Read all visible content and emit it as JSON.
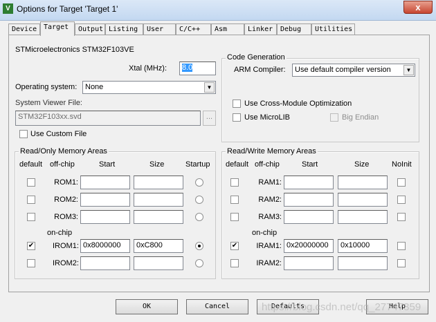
{
  "window": {
    "title": "Options for Target 'Target 1'",
    "icon": "keil-uvision-icon",
    "close": "x"
  },
  "tabs": [
    "Device",
    "Target",
    "Output",
    "Listing",
    "User",
    "C/C++",
    "Asm",
    "Linker",
    "Debug",
    "Utilities"
  ],
  "active_tab": "Target",
  "device": "STMicroelectronics STM32F103VE",
  "xtal": {
    "label": "Xtal (MHz):",
    "value": "8.0"
  },
  "os": {
    "label": "Operating system:",
    "value": "None"
  },
  "svf": {
    "label": "System Viewer File:",
    "value": "STM32F103xx.svd",
    "browse": "..."
  },
  "custom_file": {
    "label": "Use Custom File",
    "checked": false
  },
  "codegen": {
    "title": "Code Generation",
    "compiler_label": "ARM Compiler:",
    "compiler_value": "Use default compiler version",
    "cross_module": "Use Cross-Module Optimization",
    "microlib": "Use MicroLIB",
    "big_endian": "Big Endian"
  },
  "rom": {
    "title": "Read/Only Memory Areas",
    "headers": [
      "default",
      "off-chip",
      "Start",
      "Size",
      "Startup"
    ],
    "onchip": "on-chip",
    "rows": [
      {
        "name": "ROM1:",
        "start": "",
        "size": "",
        "default": false,
        "sel": false
      },
      {
        "name": "ROM2:",
        "start": "",
        "size": "",
        "default": false,
        "sel": false
      },
      {
        "name": "ROM3:",
        "start": "",
        "size": "",
        "default": false,
        "sel": false
      },
      {
        "name": "IROM1:",
        "start": "0x8000000",
        "size": "0xC800",
        "default": true,
        "sel": true
      },
      {
        "name": "IROM2:",
        "start": "",
        "size": "",
        "default": false,
        "sel": false
      }
    ]
  },
  "ram": {
    "title": "Read/Write Memory Areas",
    "headers": [
      "default",
      "off-chip",
      "Start",
      "Size",
      "NoInit"
    ],
    "onchip": "on-chip",
    "rows": [
      {
        "name": "RAM1:",
        "start": "",
        "size": "",
        "default": false,
        "sel": false
      },
      {
        "name": "RAM2:",
        "start": "",
        "size": "",
        "default": false,
        "sel": false
      },
      {
        "name": "RAM3:",
        "start": "",
        "size": "",
        "default": false,
        "sel": false
      },
      {
        "name": "IRAM1:",
        "start": "0x20000000",
        "size": "0x10000",
        "default": true,
        "sel": false
      },
      {
        "name": "IRAM2:",
        "start": "",
        "size": "",
        "default": false,
        "sel": false
      }
    ]
  },
  "buttons": {
    "ok": "OK",
    "cancel": "Cancel",
    "defaults": "Defaults",
    "help": "Help"
  },
  "watermark": "https://blog.csdn.net/qq_27747359"
}
